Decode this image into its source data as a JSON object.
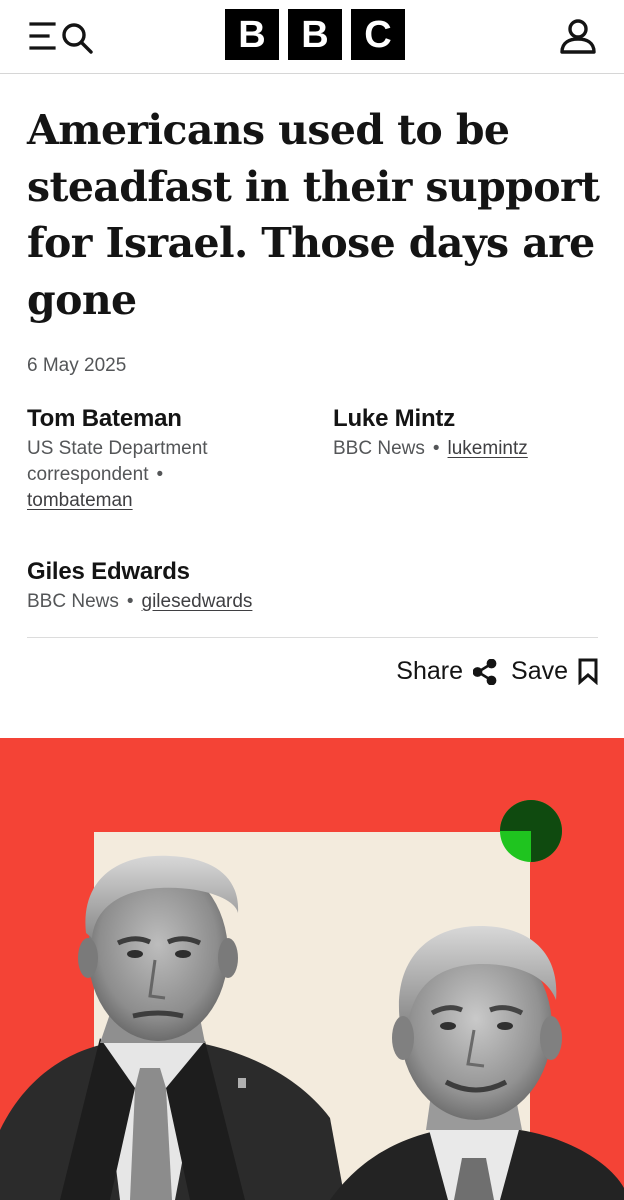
{
  "header": {
    "logo_letters": [
      "B",
      "B",
      "C"
    ],
    "icons": {
      "menu": "menu-icon",
      "search": "search-icon",
      "account": "account-icon"
    }
  },
  "article": {
    "headline": "Americans used to be steadfast in their support for Israel. Those days are gone",
    "date": "6 May 2025",
    "authors": [
      {
        "name": "Tom Bateman",
        "role": "US State Department correspondent",
        "handle": "tombateman"
      },
      {
        "name": "Luke Mintz",
        "role": "BBC News",
        "handle": "lukemintz"
      },
      {
        "name": "Giles Edwards",
        "role": "BBC News",
        "handle": "gilesedwards"
      }
    ],
    "separator": "•",
    "actions": {
      "share_label": "Share",
      "save_label": "Save"
    }
  },
  "hero": {
    "colors": {
      "background": "#f44336",
      "panel": "#f3ebdd",
      "dot_green": "#1fc41f",
      "dot_dark": "#0f4a0f"
    }
  }
}
